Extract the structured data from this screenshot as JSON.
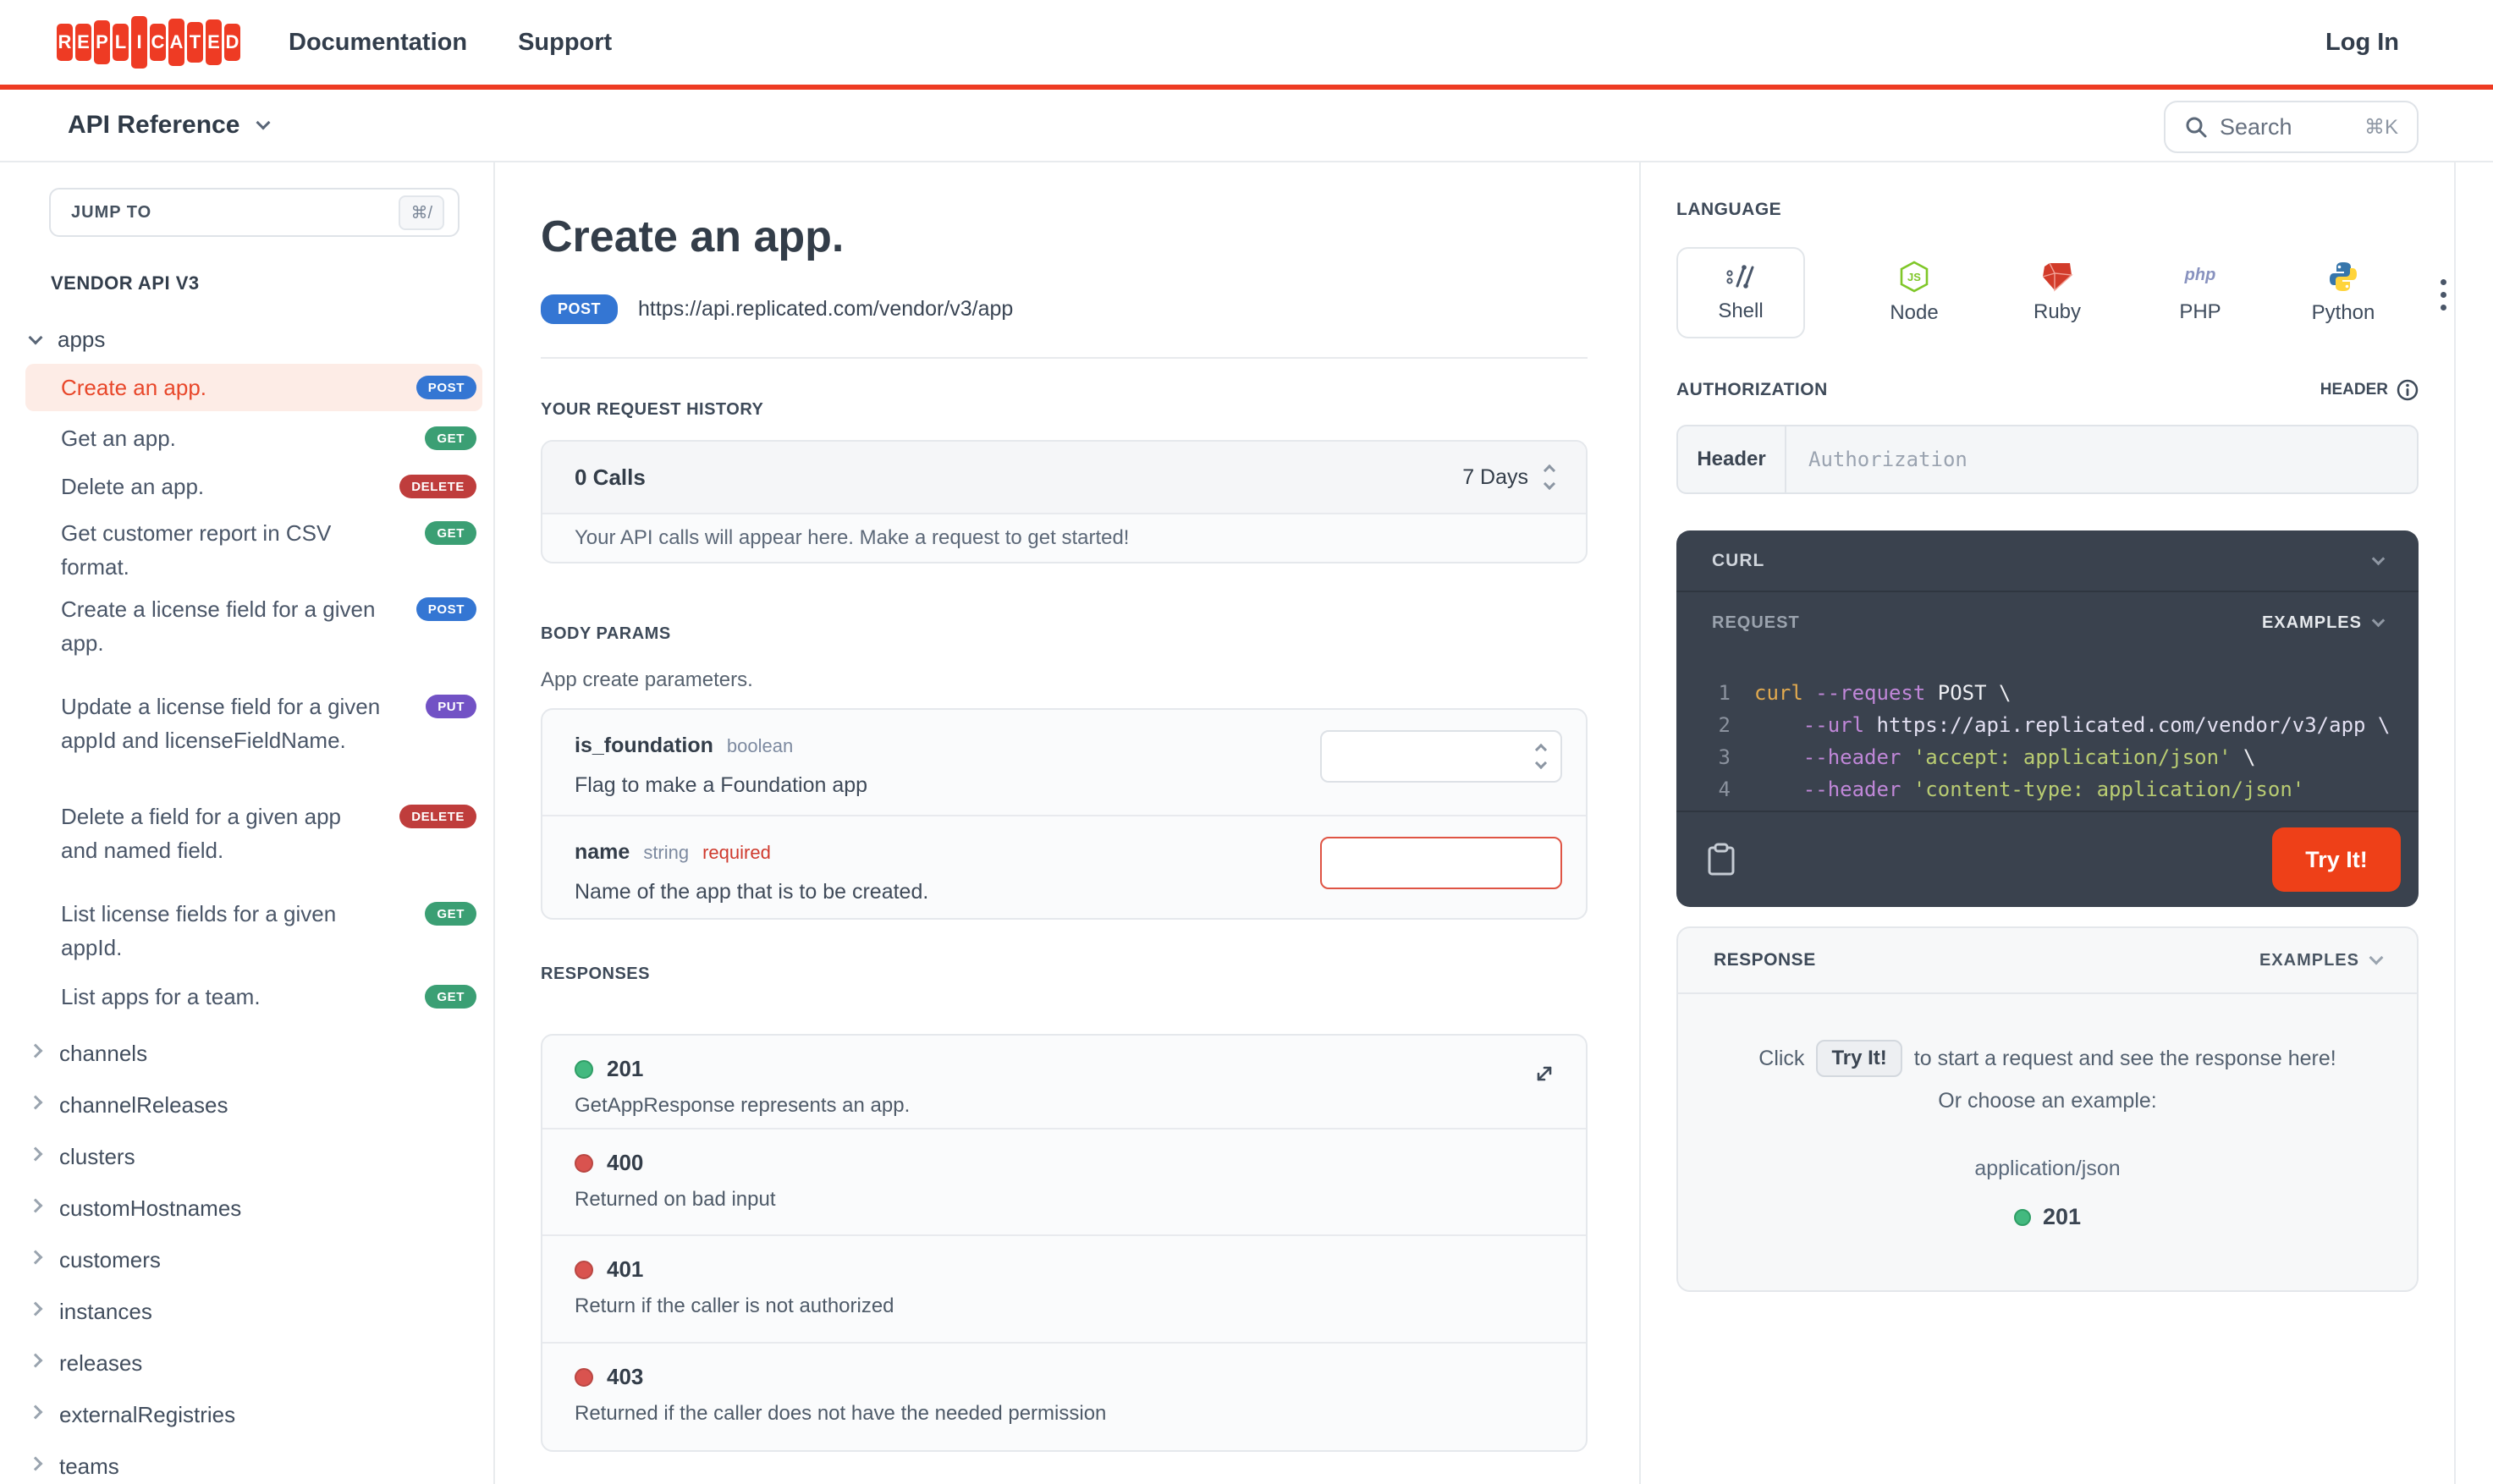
{
  "nav": {
    "brand": "REPLICATED",
    "logo_letters": [
      "R",
      "E",
      "P",
      "L",
      "I",
      "C",
      "A",
      "T",
      "E",
      "D"
    ],
    "links": [
      {
        "label": "Documentation"
      },
      {
        "label": "Support"
      }
    ],
    "login_label": "Log In"
  },
  "subheader": {
    "title": "API Reference",
    "search_placeholder": "Search",
    "search_shortcut": "⌘K"
  },
  "sidebar": {
    "jump_to_label": "JUMP TO",
    "jump_to_shortcut": "⌘/",
    "section_title": "VENDOR API V3",
    "group_label": "apps",
    "endpoints": [
      {
        "label": "Create an app.",
        "method": "POST",
        "selected": true
      },
      {
        "label": "Get an app.",
        "method": "GET",
        "selected": false
      },
      {
        "label": "Delete an app.",
        "method": "DELETE",
        "selected": false
      },
      {
        "label": "Get customer report in CSV format.",
        "method": "GET",
        "selected": false
      },
      {
        "label": "Create a license field for a given app.",
        "method": "POST",
        "selected": false
      },
      {
        "label": "Update a license field for a given appId and licenseFieldName.",
        "method": "PUT",
        "selected": false
      },
      {
        "label": "Delete a field for a given app and named field.",
        "method": "DELETE",
        "selected": false
      },
      {
        "label": "List license fields for a given appId.",
        "method": "GET",
        "selected": false
      },
      {
        "label": "List apps for a team.",
        "method": "GET",
        "selected": false
      }
    ],
    "categories": [
      {
        "label": "channels"
      },
      {
        "label": "channelReleases"
      },
      {
        "label": "clusters"
      },
      {
        "label": "customHostnames"
      },
      {
        "label": "customers"
      },
      {
        "label": "instances"
      },
      {
        "label": "releases"
      },
      {
        "label": "externalRegistries"
      },
      {
        "label": "teams"
      }
    ]
  },
  "main": {
    "title": "Create an app.",
    "method": "POST",
    "url": "https://api.replicated.com/vendor/v3/app",
    "request_history": {
      "heading": "YOUR REQUEST HISTORY",
      "calls": "0 Calls",
      "range": "7 Days",
      "empty_message": "Your API calls will appear here. Make a request to get started!"
    },
    "body_params": {
      "heading": "BODY PARAMS",
      "description": "App create parameters.",
      "params": [
        {
          "name": "is_foundation",
          "type": "boolean",
          "required": false,
          "required_label": "",
          "description": "Flag to make a Foundation app",
          "control": "select",
          "value": ""
        },
        {
          "name": "name",
          "type": "string",
          "required": true,
          "required_label": "required",
          "description": "Name of the app that is to be created.",
          "control": "input",
          "value": ""
        }
      ]
    },
    "responses": {
      "heading": "RESPONSES",
      "items": [
        {
          "code": "201",
          "status": "success",
          "description": "GetAppResponse represents an app.",
          "expandable": true
        },
        {
          "code": "400",
          "status": "error",
          "description": "Returned on bad input",
          "expandable": false
        },
        {
          "code": "401",
          "status": "error",
          "description": "Return if the caller is not authorized",
          "expandable": false
        },
        {
          "code": "403",
          "status": "error",
          "description": "Returned if the caller does not have the needed permission",
          "expandable": false
        }
      ]
    }
  },
  "panel": {
    "language": {
      "heading": "LANGUAGE",
      "options": [
        {
          "label": "Shell",
          "selected": true
        },
        {
          "label": "Node",
          "selected": false
        },
        {
          "label": "Ruby",
          "selected": false
        },
        {
          "label": "PHP",
          "selected": false
        },
        {
          "label": "Python",
          "selected": false
        }
      ]
    },
    "authorization": {
      "heading": "AUTHORIZATION",
      "type_label": "HEADER",
      "field_label": "Header",
      "placeholder": "Authorization",
      "value": ""
    },
    "curl": {
      "title": "CURL",
      "request_label": "REQUEST",
      "examples_label": "EXAMPLES",
      "try_it_label": "Try It!",
      "code": [
        {
          "num": "1",
          "tokens": [
            {
              "c": "cmd",
              "t": "curl "
            },
            {
              "c": "flag",
              "t": "--request"
            },
            {
              "c": "plain",
              "t": " POST \\"
            }
          ]
        },
        {
          "num": "2",
          "tokens": [
            {
              "c": "plain",
              "t": "    "
            },
            {
              "c": "flag",
              "t": "--url"
            },
            {
              "c": "url",
              "t": " https://api.replicated.com/vendor/v3/app \\"
            }
          ]
        },
        {
          "num": "3",
          "tokens": [
            {
              "c": "plain",
              "t": "    "
            },
            {
              "c": "flag",
              "t": "--header"
            },
            {
              "c": "str",
              "t": " 'accept: application/json'"
            },
            {
              "c": "plain",
              "t": " \\"
            }
          ]
        },
        {
          "num": "4",
          "tokens": [
            {
              "c": "plain",
              "t": "    "
            },
            {
              "c": "flag",
              "t": "--header"
            },
            {
              "c": "str",
              "t": " 'content-type: application/json'"
            }
          ]
        }
      ]
    },
    "response": {
      "title": "RESPONSE",
      "examples_label": "EXAMPLES",
      "hint_pre": "Click",
      "hint_button": "Try It!",
      "hint_post": "to start a request and see the response here!",
      "hint_line2": "Or choose an example:",
      "example_type": "application/json",
      "example_code": "201"
    }
  },
  "colors": {
    "accent_red": "#ee3b23",
    "try_it_red": "#ee4018",
    "selected_item_red": "#e8472a",
    "method_post": "#3476d3",
    "method_get": "#3b9f74",
    "method_delete": "#bf3d3c",
    "method_put": "#7252c5",
    "status_success_dot": "#43b97f",
    "status_error_dot": "#d9534f",
    "dark_panel": "#3a424e"
  }
}
